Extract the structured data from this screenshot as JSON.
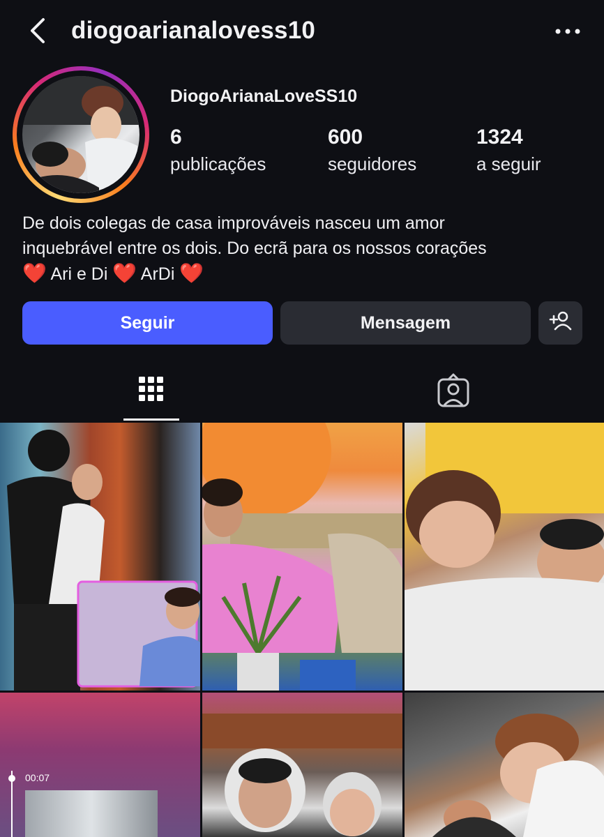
{
  "header": {
    "username": "diogoarianalovess10",
    "back_icon": "chevron-left-icon",
    "more_icon": "more-horizontal-icon"
  },
  "profile": {
    "display_name": "DiogoArianaLoveSS10",
    "stats": [
      {
        "value": "6",
        "label": "publicações"
      },
      {
        "value": "600",
        "label": "seguidores"
      },
      {
        "value": "1324",
        "label": "a seguir"
      }
    ],
    "bio": {
      "line1": "De dois colegas de casa improváveis nasceu um amor",
      "line2": "inquebrável entre os dois. Do ecrã para os nossos corações",
      "line3_part1": " Ari e Di ",
      "line3_part2": " ArDi ",
      "heart": "❤️"
    }
  },
  "actions": {
    "follow_label": "Seguir",
    "message_label": "Mensagem",
    "add_user_icon": "add-person-icon"
  },
  "colors": {
    "background": "#0e0f14",
    "follow_button": "#4a5dff",
    "secondary_button": "#2a2c33",
    "heart": "#e0242b"
  },
  "tabs": [
    {
      "name": "posts-grid",
      "icon": "grid-icon",
      "active": true
    },
    {
      "name": "tagged",
      "icon": "tagged-person-icon",
      "active": false
    }
  ],
  "posts": {
    "video_time": "00:07"
  }
}
